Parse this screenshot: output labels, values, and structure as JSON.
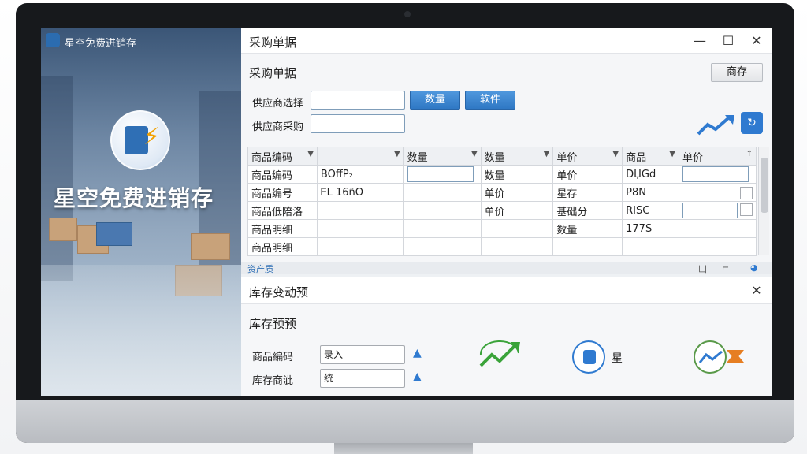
{
  "left_panel": {
    "app_title": "星空免费进销存",
    "brand_text": "星空免费进销存"
  },
  "purchase_window": {
    "title": "采购单据",
    "heading": "采购单据",
    "save_button": "商存",
    "supplier_select_label": "供应商选择",
    "supplier_purchase_label": "供应商采购",
    "quantity_button": "数量",
    "software_button": "软件",
    "columns": [
      "商品编码",
      "",
      "数量",
      "数量",
      "单价",
      "商品",
      "单价"
    ],
    "rows": [
      [
        "商品编码",
        "BOffP₂",
        "",
        "数量",
        "单价",
        "DЏGd",
        ""
      ],
      [
        "商品编号",
        "ᖴL 16ñO",
        "",
        "单价",
        "星存",
        "P8N",
        ""
      ],
      [
        "商品低陪洛",
        "",
        "",
        "单价",
        "基础分",
        "RISC",
        ""
      ],
      [
        "商品明细",
        "",
        "",
        "",
        "数量",
        "177S",
        ""
      ],
      [
        "商品明细",
        "",
        "",
        "",
        "",
        "",
        ""
      ]
    ],
    "status_text": "资产质",
    "status_icons": [
      "凵",
      "⌐",
      "◕"
    ]
  },
  "inventory_window": {
    "title": "库存变动预",
    "heading": "库存预预",
    "code_label": "商品編码",
    "code_value": "录入",
    "stock_label": "库存商泚",
    "stock_value": "统",
    "icon_label": "星"
  },
  "colors": {
    "accent_blue": "#2f78c4",
    "window_bg": "#f5f6f8",
    "trend_green": "#3aa33a"
  }
}
